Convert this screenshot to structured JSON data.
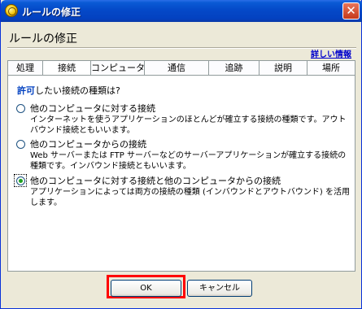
{
  "window": {
    "title": "ルールの修正",
    "close_glyph": "✕"
  },
  "page_title": "ルールの修正",
  "details_link": "詳しい情報",
  "tabs": [
    {
      "label": "処理",
      "active": false
    },
    {
      "label": "接続",
      "active": true
    },
    {
      "label": "コンピュータ",
      "active": false
    },
    {
      "label": "通信",
      "active": false
    },
    {
      "label": "追跡",
      "active": false
    },
    {
      "label": "説明",
      "active": false
    },
    {
      "label": "場所",
      "active": false
    }
  ],
  "question": {
    "highlight": "許可",
    "rest": "したい接続の種類は?"
  },
  "options": [
    {
      "label": "他のコンピュータに対する接続",
      "desc": "インターネットを使うアプリケーションのほとんどが確立する接続の種類です。アウトバウンド接続ともいいます。",
      "checked": false
    },
    {
      "label": "他のコンピュータからの接続",
      "desc": "Web サーバーまたは FTP サーバーなどのサーバーアプリケーションが確立する接続の種類です。インバウンド接続ともいいます。",
      "checked": false
    },
    {
      "label": "他のコンピュータに対する接続と他のコンピュータからの接続",
      "desc": "アプリケーションによっては両方の接続の種類 (インバウンドとアウトバウンド) を活用します。",
      "checked": true
    }
  ],
  "buttons": {
    "ok": "OK",
    "cancel": "キャンセル"
  },
  "colors": {
    "title_bar": "#0449c8",
    "highlight_box": "#ff0000",
    "link": "#0000cc",
    "question_highlight": "#0040c0",
    "radio_dot": "#21a121"
  }
}
